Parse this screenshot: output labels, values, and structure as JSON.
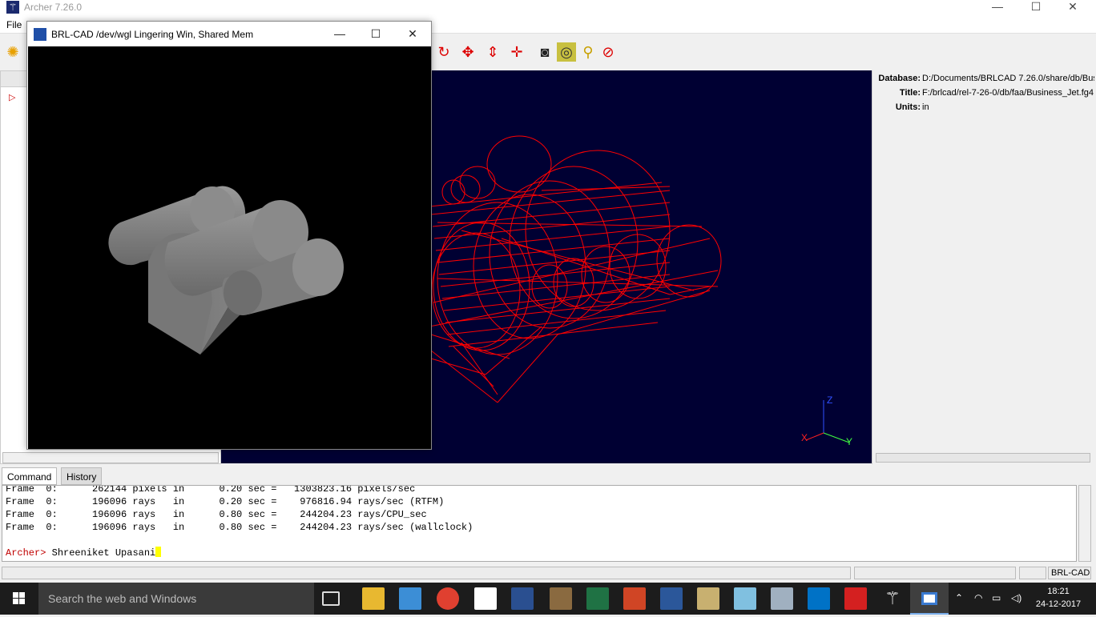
{
  "window": {
    "title": "Archer 7.26.0",
    "minimize": "—",
    "maximize": "☐",
    "close": "✕"
  },
  "menu": {
    "file": "File"
  },
  "toolbar": {
    "icons": [
      "new-icon",
      "rotate-icon",
      "translate-icon",
      "scale-icon",
      "center-icon",
      "camera-icon",
      "raytrace-icon",
      "broom-icon",
      "stop-icon"
    ]
  },
  "attributes": {
    "database": {
      "key": "Database:",
      "value": "D:/Documents/BRLCAD 7.26.0/share/db/Bus"
    },
    "title": {
      "key": "Title:",
      "value": "F:/brlcad/rel-7-26-0/db/faa/Business_Jet.fg4"
    },
    "units": {
      "key": "Units:",
      "value": "in"
    }
  },
  "render_window": {
    "title": "BRL-CAD /dev/wgl Lingering Win, Shared Mem",
    "minimize": "—",
    "maximize": "☐",
    "close": "✕"
  },
  "axes": {
    "x": "X",
    "y": "Y",
    "z": "Z"
  },
  "tabs": {
    "command": "Command",
    "history": "History"
  },
  "console": {
    "lines": [
      "Frame  0:      262144 pixels in      0.20 sec =   1303823.16 pixels/sec",
      "Frame  0:      196096 rays   in      0.20 sec =    976816.94 rays/sec (RTFM)",
      "Frame  0:      196096 rays   in      0.80 sec =    244204.23 rays/CPU_sec",
      "Frame  0:      196096 rays   in      0.80 sec =    244204.23 rays/sec (wallclock)"
    ],
    "prompt": "Archer>",
    "input": " Shreeniket Upasani"
  },
  "status": {
    "app": "BRL-CAD"
  },
  "taskbar": {
    "search_placeholder": "Search the web and Windows",
    "time": "18:21",
    "date": "24-12-2017"
  },
  "colors": {
    "viewport_bg": "#000033",
    "wireframe": "#ff0000",
    "prompt": "#c00000"
  }
}
